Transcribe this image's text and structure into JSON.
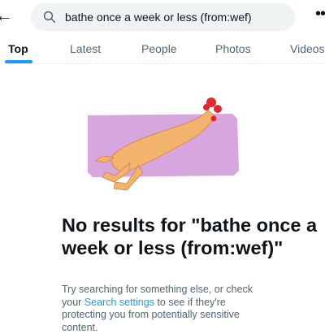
{
  "search": {
    "query": "bathe once a week or less (from:wef)"
  },
  "tabs": [
    {
      "label": "Top"
    },
    {
      "label": "Latest"
    },
    {
      "label": "People"
    },
    {
      "label": "Photos"
    },
    {
      "label": "Videos"
    }
  ],
  "empty_state": {
    "title": "No results for \"bathe once a week or less (from:wef)\"",
    "message_before": "Try searching for something else, or check your ",
    "link_text": "Search settings",
    "message_after": " to see if they're protecting you from potentially sensitive content."
  },
  "colors": {
    "accent": "#1d9bf0",
    "secondary_text": "#536471",
    "illustration_bg": "#d7a6df"
  }
}
